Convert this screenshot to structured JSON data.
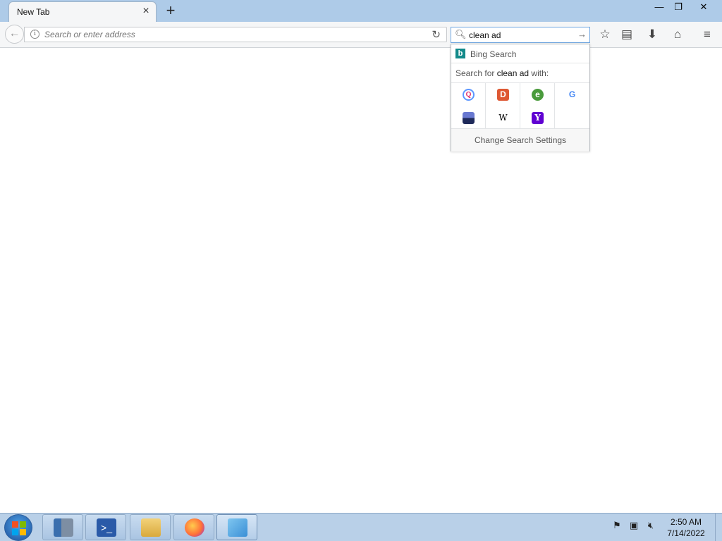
{
  "browser": {
    "tab": {
      "title": "New Tab"
    },
    "urlbar": {
      "placeholder": "Search or enter address"
    },
    "searchbar": {
      "value": "clean ad"
    },
    "window_controls": {
      "minimize": "—",
      "restore": "❐",
      "close": "✕"
    }
  },
  "search_popup": {
    "current_engine": "Bing Search",
    "search_for_prefix": "Search for ",
    "search_query": "clean ad",
    "search_for_suffix": " with:",
    "engines": [
      {
        "name": "Qwant",
        "glyph": "Q",
        "color": "#5c97ff"
      },
      {
        "name": "DuckDuckGo",
        "glyph": "D",
        "color": "#de5833"
      },
      {
        "name": "Ecosia",
        "glyph": "e",
        "color": "#4a9b3c"
      },
      {
        "name": "Google",
        "glyph": "G",
        "color": "#4285f4"
      },
      {
        "name": "Startpage",
        "glyph": "",
        "color": "#3a4a9a"
      },
      {
        "name": "Wikipedia",
        "glyph": "W",
        "color": "#000000"
      },
      {
        "name": "Yahoo",
        "glyph": "Y",
        "color": "#6001d2"
      }
    ],
    "settings_label": "Change Search Settings"
  },
  "taskbar": {
    "apps": [
      "Server Manager",
      "PowerShell",
      "File Explorer",
      "Firefox",
      "Paint"
    ],
    "clock": {
      "time": "2:50 AM",
      "date": "7/14/2022"
    }
  }
}
